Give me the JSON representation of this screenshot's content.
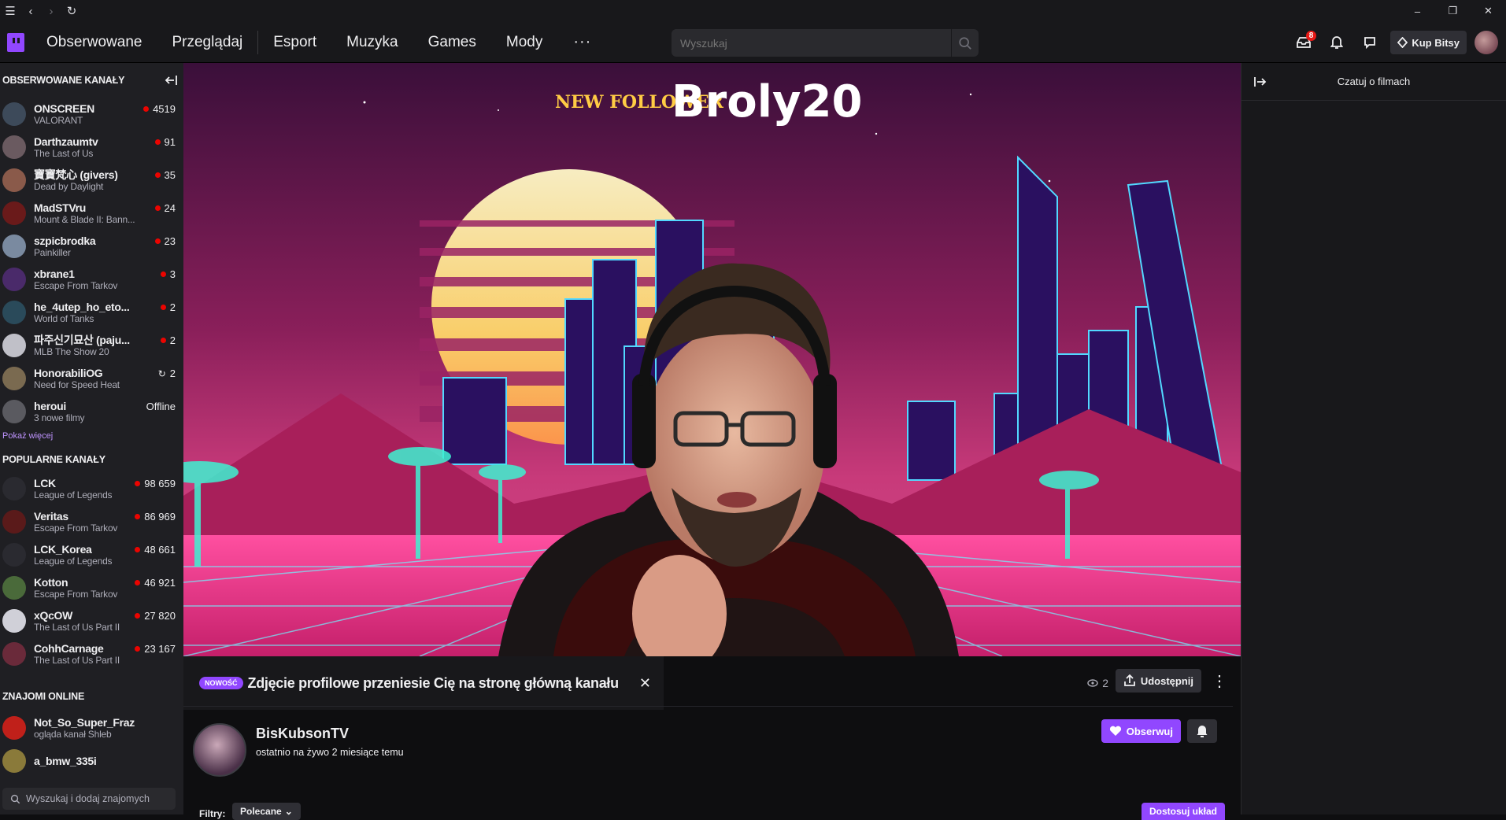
{
  "nav": {
    "links": [
      "Obserwowane",
      "Przeglądaj",
      "Esport",
      "Muzyka",
      "Games",
      "Mody"
    ],
    "more": "···",
    "search_placeholder": "Wyszukaj",
    "inbox_badge": "8",
    "bits_label": "Kup Bitsy"
  },
  "sidebar": {
    "followed_title": "OBSERWOWANE KANAŁY",
    "followed": [
      {
        "name": "ONSCREEN",
        "game": "VALORANT",
        "count": "4519",
        "status": "live",
        "color": "#3d4a5a"
      },
      {
        "name": "Darthzaumtv",
        "game": "The Last of Us",
        "count": "91",
        "status": "live",
        "color": "#6a5a60"
      },
      {
        "name": "寶寶梵心 (givers)",
        "game": "Dead by Daylight",
        "count": "35",
        "status": "live",
        "color": "#8a5a4a"
      },
      {
        "name": "MadSTVru",
        "game": "Mount & Blade II: Bann...",
        "count": "24",
        "status": "live",
        "color": "#6a1a1a"
      },
      {
        "name": "szpicbrodka",
        "game": "Painkiller",
        "count": "23",
        "status": "live",
        "color": "#7a8aa0"
      },
      {
        "name": "xbrane1",
        "game": "Escape From Tarkov",
        "count": "3",
        "status": "live",
        "color": "#4a2a6a"
      },
      {
        "name": "he_4utep_ho_eto...",
        "game": "World of Tanks",
        "count": "2",
        "status": "live",
        "color": "#2a4a5a"
      },
      {
        "name": "파주신기묘산 (paju...",
        "game": "MLB The Show 20",
        "count": "2",
        "status": "live",
        "color": "#c0c0c8"
      },
      {
        "name": "HonorabiliOG",
        "game": "Need for Speed Heat",
        "count": "2",
        "status": "rerun",
        "color": "#7a6a50"
      },
      {
        "name": "heroui",
        "game": "3 nowe filmy",
        "count": "Offline",
        "status": "offline",
        "color": "#5a5a60"
      }
    ],
    "show_more": "Pokaż więcej",
    "popular_title": "POPULARNE KANAŁY",
    "popular": [
      {
        "name": "LCK",
        "game": "League of Legends",
        "count": "98 659",
        "color": "#2a2a30"
      },
      {
        "name": "Veritas",
        "game": "Escape From Tarkov",
        "count": "86 969",
        "color": "#5a1a1a"
      },
      {
        "name": "LCK_Korea",
        "game": "League of Legends",
        "count": "48 661",
        "color": "#2a2a30"
      },
      {
        "name": "Kotton",
        "game": "Escape From Tarkov",
        "count": "46 921",
        "color": "#4a6a3a"
      },
      {
        "name": "xQcOW",
        "game": "The Last of Us Part II",
        "count": "27 820",
        "color": "#d0d0d8"
      },
      {
        "name": "CohhCarnage",
        "game": "The Last of Us Part II",
        "count": "23 167",
        "color": "#6a2a3a"
      }
    ],
    "friends_title": "ZNAJOMI ONLINE",
    "friends": [
      {
        "name": "Not_So_Super_Fraz",
        "game": "ogląda kanał Shleb",
        "color": "#c0201a"
      },
      {
        "name": "a_bmw_335i",
        "game": "",
        "color": "#8a7a3a"
      }
    ],
    "friends_search": "Wyszukaj i dodaj znajomych"
  },
  "player": {
    "overlay_label": "NEW FOLLOWER",
    "overlay_name": "Broly20"
  },
  "channel": {
    "notice_badge": "NOWOŚĆ",
    "notice_text": "Zdjęcie profilowe przeniesie Cię na stronę główną kanału",
    "viewers": "2",
    "share_label": "Udostępnij",
    "name": "BisKubsonTV",
    "subtitle": "ostatnio na żywo 2 miesiące temu",
    "follow_label": "Obserwuj",
    "filter_label": "Filtry:",
    "filter_value": "Polecane",
    "layout_label": "Dostosuj układ"
  },
  "chat": {
    "title": "Czatuj o filmach"
  },
  "colors": {
    "accent": "#9147ff",
    "live": "#eb0400"
  }
}
